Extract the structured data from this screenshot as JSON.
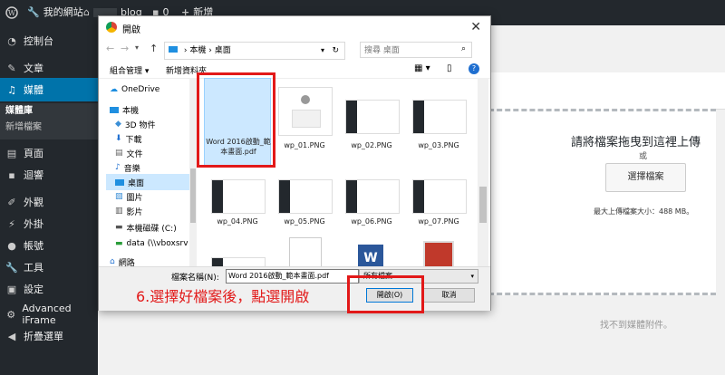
{
  "adminbar": {
    "site_name": "我的網站",
    "blog_name": "blog",
    "comments_count": "0",
    "new_label": "新增"
  },
  "sidebar": {
    "items": [
      {
        "label": "控制台",
        "icon": "dashboard-icon"
      },
      {
        "label": "文章",
        "icon": "pin-icon"
      },
      {
        "label": "媒體",
        "icon": "media-icon"
      },
      {
        "label": "頁面",
        "icon": "page-icon"
      },
      {
        "label": "迴響",
        "icon": "comment-icon"
      },
      {
        "label": "外觀",
        "icon": "brush-icon"
      },
      {
        "label": "外掛",
        "icon": "plugin-icon"
      },
      {
        "label": "帳號",
        "icon": "user-icon"
      },
      {
        "label": "工具",
        "icon": "wrench-icon"
      },
      {
        "label": "設定",
        "icon": "settings-icon"
      },
      {
        "label": "Advanced iFrame",
        "icon": "gear-icon"
      },
      {
        "label": "折疊選單",
        "icon": "collapse-icon"
      }
    ],
    "submenu": [
      "媒體庫",
      "新增檔案"
    ]
  },
  "upload": {
    "drop_text": "請將檔案拖曳到這裡上傳",
    "or": "或",
    "select_button": "選擇檔案",
    "max_size": "最大上傳檔案大小：488 MB。",
    "no_media": "找不到媒體附件。"
  },
  "dialog": {
    "title": "開啟",
    "path": [
      "本機",
      "桌面"
    ],
    "search_placeholder": "搜尋 桌面",
    "organize": "組合管理 ▾",
    "new_folder": "新增資料夾",
    "tree": [
      {
        "label": "OneDrive",
        "icon": "cloud-icon"
      },
      {
        "label": "本機",
        "icon": "computer-icon"
      },
      {
        "label": "3D 物件",
        "icon": "cube-icon"
      },
      {
        "label": "下載",
        "icon": "download-icon"
      },
      {
        "label": "文件",
        "icon": "document-icon"
      },
      {
        "label": "音樂",
        "icon": "music-icon"
      },
      {
        "label": "桌面",
        "icon": "desktop-icon"
      },
      {
        "label": "圖片",
        "icon": "picture-icon"
      },
      {
        "label": "影片",
        "icon": "video-icon"
      },
      {
        "label": "本機磁碟 (C:)",
        "icon": "drive-icon"
      },
      {
        "label": "data (\\\\vboxsrv",
        "icon": "network-drive-icon"
      },
      {
        "label": "網路",
        "icon": "network-icon"
      }
    ],
    "files": [
      {
        "name": "Word 2016啟動_範本畫面.pdf",
        "type": "pdf"
      },
      {
        "name": "wp_01.PNG",
        "type": "png"
      },
      {
        "name": "wp_02.PNG",
        "type": "png"
      },
      {
        "name": "wp_03.PNG",
        "type": "png"
      },
      {
        "name": "wp_04.PNG",
        "type": "png"
      },
      {
        "name": "wp_05.PNG",
        "type": "png"
      },
      {
        "name": "wp_06.PNG",
        "type": "png"
      },
      {
        "name": "wp_07.PNG",
        "type": "png"
      },
      {
        "name": "",
        "type": "png"
      },
      {
        "name": "",
        "type": "doc"
      },
      {
        "name": "",
        "type": "word"
      },
      {
        "name": "",
        "type": "app"
      }
    ],
    "filename_label": "檔案名稱(N):",
    "filename_value": "Word 2016啟動_範本畫面.pdf",
    "filetype": "所有檔案",
    "open_button": "開啟(O)",
    "cancel_button": "取消"
  },
  "annotation": {
    "caption": "6.選擇好檔案後，點選開啟",
    "color": "#e21919"
  }
}
